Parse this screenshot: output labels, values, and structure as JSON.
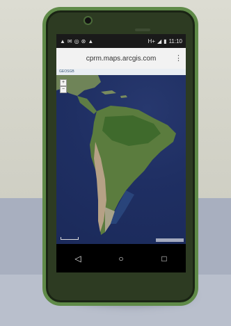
{
  "status_bar": {
    "left_icons": [
      "notification-icon",
      "alert-icon",
      "mail-icon",
      "sync-icon",
      "settings-icon",
      "warning-icon"
    ],
    "network": "H+",
    "time": "11:10"
  },
  "browser": {
    "url": "cprm.maps.arcgis.com",
    "menu_icon": "more-vert-icon"
  },
  "map": {
    "header_text": "GEOSGB",
    "zoom_in": "+",
    "zoom_out": "−"
  },
  "nav_bar": {
    "back": "◁",
    "home": "○",
    "recents": "□"
  },
  "colors": {
    "phone_case": "#5f8a48",
    "ocean": "#1f2f63",
    "land": "#6a8a4a",
    "desk": "#a8afbf",
    "wall": "#d6d6cb"
  }
}
